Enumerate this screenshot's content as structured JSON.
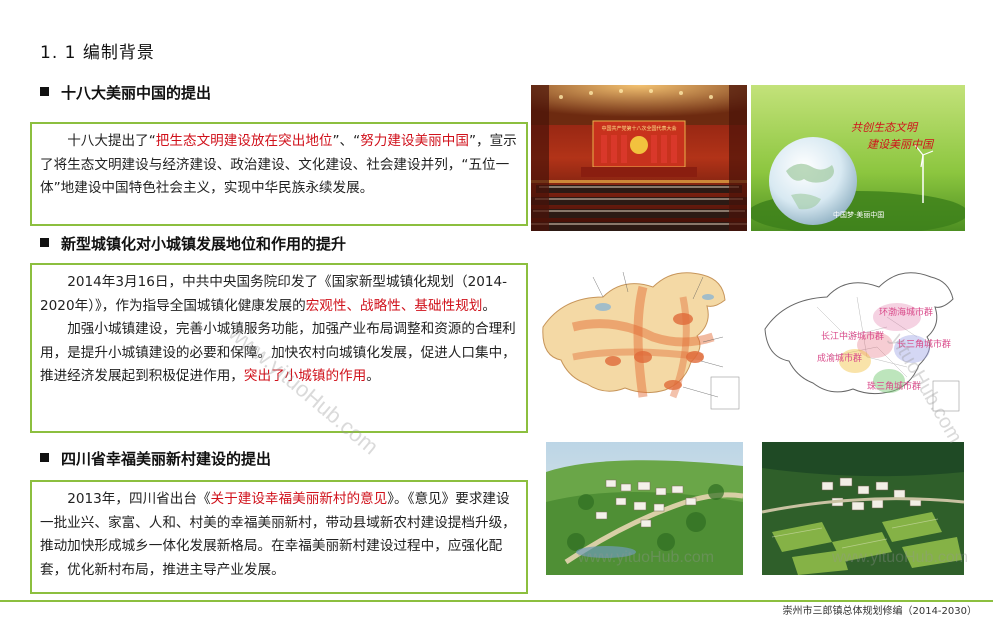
{
  "page": {
    "title": "1. 1 编制背景"
  },
  "sections": [
    {
      "heading": "十八大美丽中国的提出",
      "paragraphs": [
        {
          "runs": [
            {
              "text": "十八大提出了“",
              "red": false
            },
            {
              "text": "把生态文明建设放在突出地位",
              "red": true
            },
            {
              "text": "”、“",
              "red": false
            },
            {
              "text": "努力建设美丽中国",
              "red": true
            },
            {
              "text": "”，宣示了将生态文明建设与经济建设、政治建设、文化建设、社会建设并列，“五位一体”地建设中国特色社会主义，实现中华民族永续发展。",
              "red": false
            }
          ]
        }
      ]
    },
    {
      "heading": "新型城镇化对小城镇发展地位和作用的提升",
      "paragraphs": [
        {
          "runs": [
            {
              "text": "2014年3月16日，中共中央国务院印发了《国家新型城镇化规划（2014-2020年）》，作为指导全国城镇化健康发展的",
              "red": false
            },
            {
              "text": "宏观性、战略性、基础性规划",
              "red": true
            },
            {
              "text": "。",
              "red": false
            }
          ]
        },
        {
          "runs": [
            {
              "text": "加强小城镇建设，完善小城镇服务功能，加强产业布局调整和资源的合理利用，是提升小城镇建设的必要和保障。加快农村向城镇化发展，促进人口集中，推进经济发展起到积极促进作用，",
              "red": false
            },
            {
              "text": "突出了小城镇的作用",
              "red": true
            },
            {
              "text": "。",
              "red": false
            }
          ]
        }
      ]
    },
    {
      "heading": "四川省幸福美丽新村建设的提出",
      "paragraphs": [
        {
          "runs": [
            {
              "text": "2013年，四川省出台《",
              "red": false
            },
            {
              "text": "关于建设幸福美丽新村的意见",
              "red": true
            },
            {
              "text": "》。《意见》要求建设一批业兴、家富、人和、村美的幸福美丽新村，带动县域新农村建设提档升级，推动加快形成城乡一体化发展新格局。在幸福美丽新村建设过程中，应强化配套，优化新村布局，推进主导产业发展。",
              "red": false
            }
          ]
        }
      ]
    }
  ],
  "images": {
    "congress_banner": "中国共产党第十八次全国代表大会",
    "globe_slogan_line1": "共创生态文明",
    "globe_slogan_line2": "建设美丽中国",
    "globe_logo": "中国梦·美丽中国",
    "map_labels": [
      {
        "text": "环渤海城市群",
        "color": "#d94a8a"
      },
      {
        "text": "长江中游城市群",
        "color": "#d94a8a"
      },
      {
        "text": "长三角城市群",
        "color": "#d94a8a"
      },
      {
        "text": "成渝城市群",
        "color": "#d94a8a"
      },
      {
        "text": "珠三角城市群",
        "color": "#d94a8a"
      }
    ]
  },
  "watermarks": [
    "www.yituoHub.com",
    "www.yituoHub.com",
    "www.yituoHub.com",
    "yituoHub.com"
  ],
  "footer": {
    "text": "崇州市三郎镇总体规划修编（2014-2030）"
  },
  "colors": {
    "accent_green": "#8cbf3f",
    "highlight_red": "#d0111b"
  }
}
